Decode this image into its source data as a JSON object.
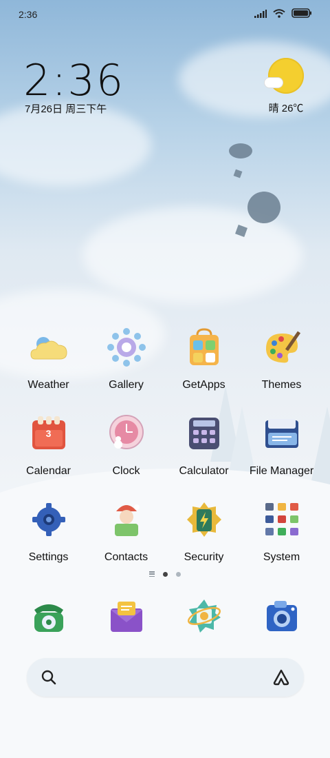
{
  "status_bar": {
    "time": "2:36"
  },
  "clock_widget": {
    "time": "2:36",
    "date": "7月26日 周三下午"
  },
  "weather_widget": {
    "text": "晴 26℃",
    "icon": "sunny-cloud-icon"
  },
  "apps": [
    {
      "label": "Weather",
      "icon": "weather-icon"
    },
    {
      "label": "Gallery",
      "icon": "gallery-icon"
    },
    {
      "label": "GetApps",
      "icon": "getapps-icon"
    },
    {
      "label": "Themes",
      "icon": "themes-icon"
    },
    {
      "label": "Calendar",
      "icon": "calendar-icon",
      "badge": "3"
    },
    {
      "label": "Clock",
      "icon": "clock-icon"
    },
    {
      "label": "Calculator",
      "icon": "calculator-icon"
    },
    {
      "label": "File Manager",
      "icon": "file-manager-icon"
    },
    {
      "label": "Settings",
      "icon": "settings-icon"
    },
    {
      "label": "Contacts",
      "icon": "contacts-icon"
    },
    {
      "label": "Security",
      "icon": "security-icon"
    },
    {
      "label": "System",
      "icon": "system-folder-icon"
    }
  ],
  "pager": {
    "pages": 2,
    "active": 0
  },
  "dock": [
    {
      "icon": "phone-icon"
    },
    {
      "icon": "messages-icon"
    },
    {
      "icon": "browser-icon"
    },
    {
      "icon": "camera-icon"
    }
  ],
  "search_bar": {
    "icon": "search-icon",
    "assistant_icon": "assistant-icon"
  }
}
